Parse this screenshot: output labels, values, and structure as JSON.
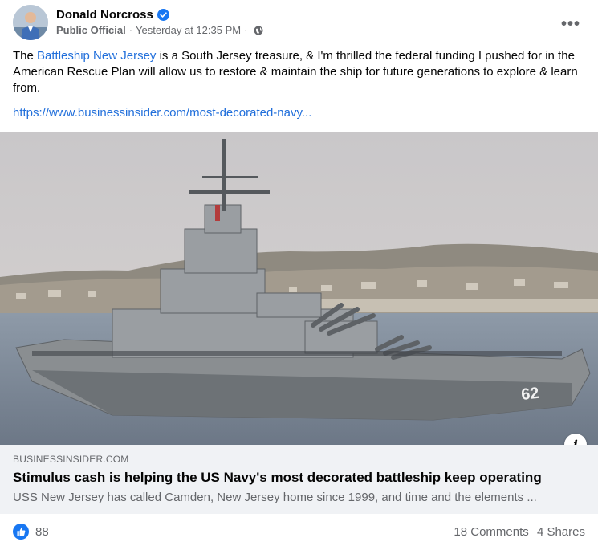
{
  "post": {
    "author": "Donald Norcross",
    "role": "Public Official",
    "separator": "·",
    "timestamp": "Yesterday at 12:35 PM",
    "privacy_icon": "globe-icon",
    "more_label": "•••",
    "text_before": "The ",
    "mention": "Battleship New Jersey",
    "text_after": " is a South Jersey treasure, & I'm thrilled the federal funding I pushed for in the American Rescue Plan will allow us to restore & maintain the ship for future generations to explore & learn from.",
    "link": "https://www.businessinsider.com/most-decorated-navy..."
  },
  "link_card": {
    "domain": "BUSINESSINSIDER.COM",
    "title": "Stimulus cash is helping the US Navy's most decorated battleship keep operating",
    "description": "USS New Jersey has called Camden, New Jersey home since 1999, and time and the elements ...",
    "hull_number": "62",
    "info_label": "i"
  },
  "footer": {
    "like_count": "88",
    "comments": "18 Comments",
    "shares": "4 Shares"
  },
  "colors": {
    "accent": "#1877f2",
    "link": "#216fdb",
    "secondary_text": "#65676b",
    "card_bg": "#f0f2f5"
  }
}
